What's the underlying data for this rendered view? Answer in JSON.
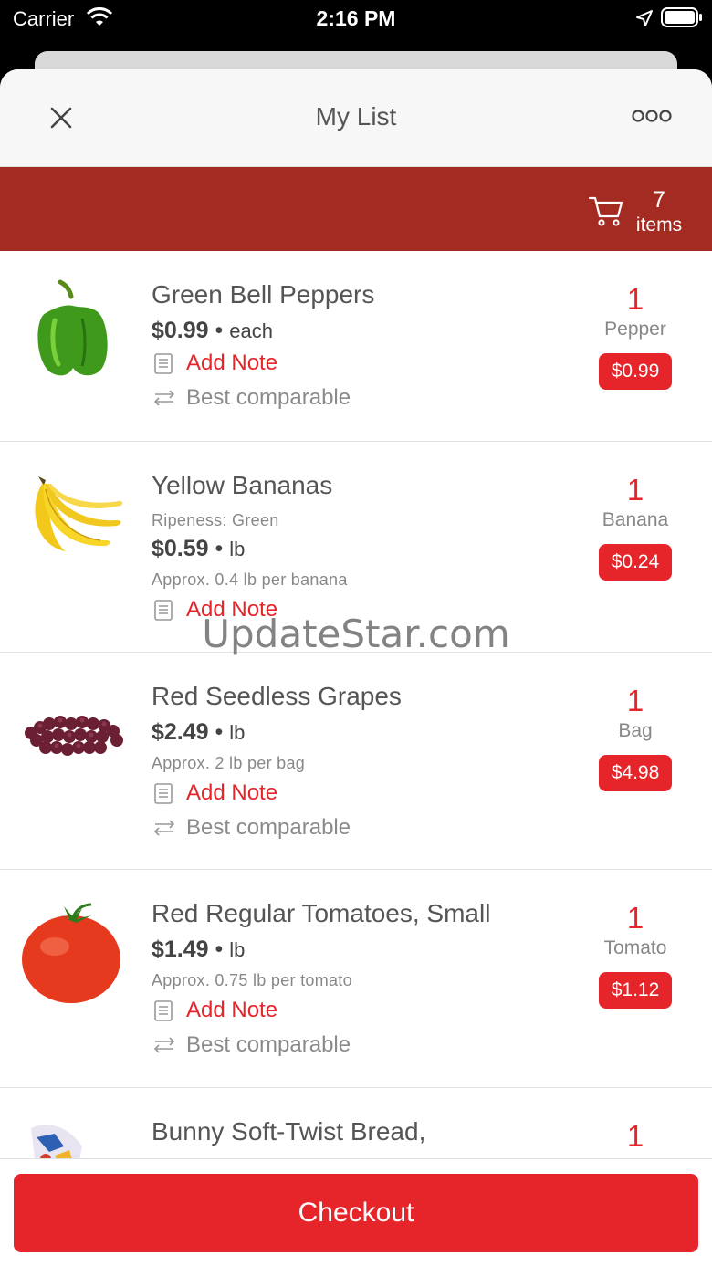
{
  "status_bar": {
    "carrier": "Carrier",
    "time": "2:16 PM"
  },
  "header": {
    "title": "My List",
    "close_icon": "close-icon",
    "more_icon": "more-icon"
  },
  "cart": {
    "count": "7",
    "count_label": "items",
    "icon": "cart-icon"
  },
  "items": [
    {
      "name": "Green Bell Peppers",
      "price": "$0.99",
      "unit": "each",
      "note_label": "Add Note",
      "compare_label": "Best comparable",
      "qty": "1",
      "qty_unit": "Pepper",
      "total": "$0.99"
    },
    {
      "name": "Yellow Bananas",
      "ripeness": "Ripeness: Green",
      "price": "$0.59",
      "unit": "lb",
      "approx": "Approx. 0.4 lb per banana",
      "note_label": "Add Note",
      "qty": "1",
      "qty_unit": "Banana",
      "total": "$0.24"
    },
    {
      "name": "Red Seedless Grapes",
      "price": "$2.49",
      "unit": "lb",
      "approx": "Approx. 2 lb per bag",
      "note_label": "Add Note",
      "compare_label": "Best comparable",
      "qty": "1",
      "qty_unit": "Bag",
      "total": "$4.98"
    },
    {
      "name": "Red Regular Tomatoes, Small",
      "price": "$1.49",
      "unit": "lb",
      "approx": "Approx. 0.75 lb per tomato",
      "note_label": "Add Note",
      "compare_label": "Best comparable",
      "qty": "1",
      "qty_unit": "Tomato",
      "total": "$1.12"
    },
    {
      "name": "Bunny Soft-Twist Bread,",
      "qty": "1"
    }
  ],
  "footer": {
    "checkout_label": "Checkout"
  },
  "watermark": "UpdateStar.com",
  "colors": {
    "accent": "#e6252a",
    "cart_bar": "#a32b22"
  }
}
